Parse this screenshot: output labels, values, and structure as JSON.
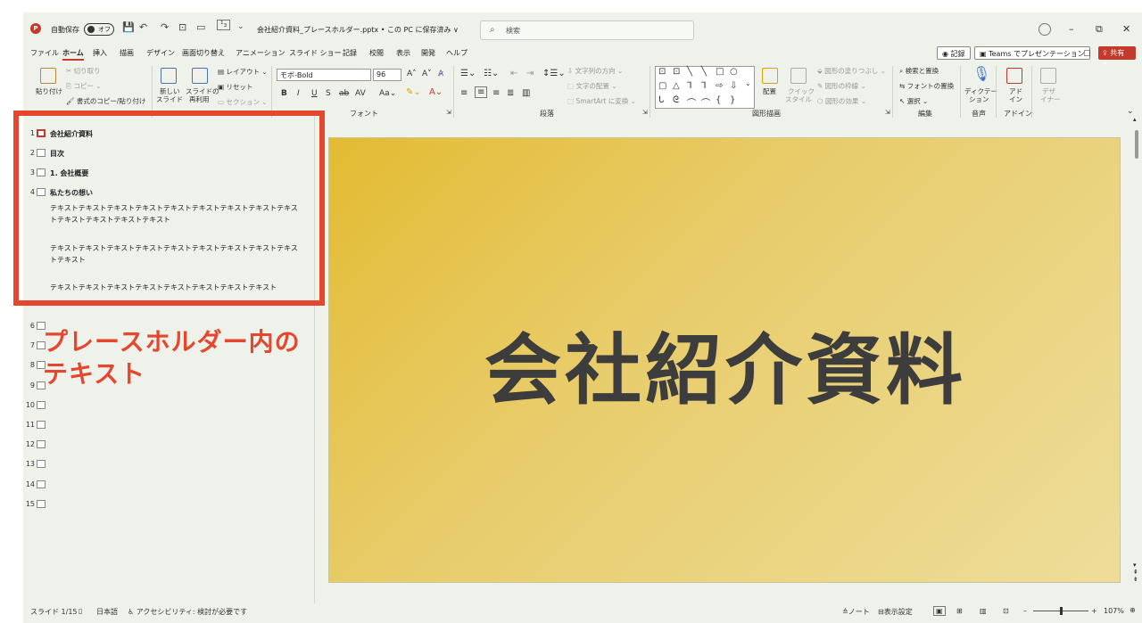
{
  "titlebar": {
    "autosave_label": "自動保存",
    "autosave_state": "オフ",
    "doc_title": "会社紹介資料_プレースホルダー.pptx • この PC に保存済み ∨",
    "search_placeholder": "検索"
  },
  "menu": {
    "tabs": [
      "ファイル",
      "ホーム",
      "挿入",
      "描画",
      "デザイン",
      "画面切り替え",
      "アニメーション",
      "スライド ショー",
      "記録",
      "校閲",
      "表示",
      "開発",
      "ヘルプ"
    ],
    "active_tab": "ホーム",
    "record_label": "記録",
    "teams_label": "Teams でプレゼンテーション",
    "share_label": "共有"
  },
  "ribbon": {
    "clipboard": {
      "paste": "貼り付け",
      "cut": "切り取り",
      "copy": "コピー",
      "format_painter": "書式のコピー/貼り付け"
    },
    "slides": {
      "new_slide": "新しい",
      "new_slide2": "スライド",
      "reuse": "スライドの",
      "reuse2": "再利用",
      "layout": "レイアウト",
      "reset": "リセット",
      "section": "セクション"
    },
    "font": {
      "name": "モボ-Bold",
      "size": "96",
      "group_label": "フォント"
    },
    "paragraph": {
      "text_direction": "文字列の方向",
      "align_text": "文字の配置",
      "smartart": "SmartArt に変換",
      "group_label": "段落"
    },
    "drawing": {
      "arrange": "配置",
      "quick_styles": "クイック",
      "quick_styles2": "スタイル",
      "shape_fill": "図形の塗りつぶし",
      "shape_outline": "図形の枠線",
      "shape_effects": "図形の効果",
      "group_label": "図形描画"
    },
    "editing": {
      "find_replace": "検索と置換",
      "replace_fonts": "フォントの置換",
      "select": "選択",
      "group_label": "編集"
    },
    "voice": {
      "dictate": "ディクテー",
      "dictate2": "ション",
      "group_label": "音声"
    },
    "addins": {
      "label": "アド",
      "label2": "イン",
      "group_label": "アドイン"
    },
    "designer": {
      "label": "デザ",
      "label2": "イナー"
    }
  },
  "outline": {
    "slides": [
      {
        "num": "1",
        "title": "会社紹介資料"
      },
      {
        "num": "2",
        "title": "目次"
      },
      {
        "num": "3",
        "title": "1. 会社概要"
      },
      {
        "num": "4",
        "title": "私たちの想い"
      }
    ],
    "body_lines": [
      "テキストテキストテキストテキストテキストテキストテキストテキストテキストテキストテキストテキストテキスト",
      "テキストテキストテキストテキストテキストテキストテキストテキストテキストテキスト",
      "テキストテキストテキストテキストテキストテキストテキストテキスト"
    ],
    "empty_nums": [
      "6",
      "7",
      "8",
      "9",
      "10",
      "11",
      "12",
      "13",
      "14",
      "15"
    ]
  },
  "annotation": {
    "line1": "プレースホルダー内の",
    "line2": "テキスト",
    "color": "#e4462e"
  },
  "slide": {
    "title": "会社紹介資料"
  },
  "statusbar": {
    "slide_count": "スライド 1/15",
    "language": "日本語",
    "accessibility": "アクセシビリティ: 検討が必要です",
    "notes": "ノート",
    "display_settings": "表示設定",
    "zoom": "107%"
  }
}
